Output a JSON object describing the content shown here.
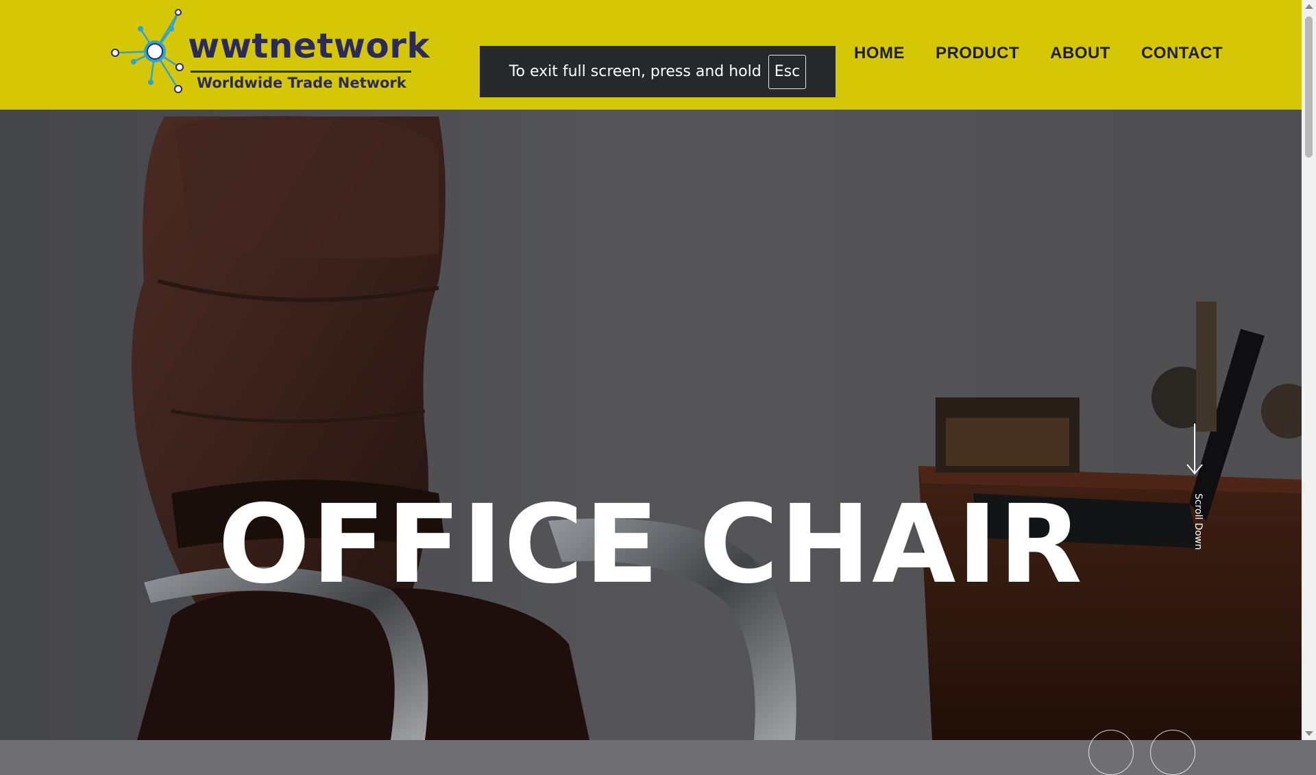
{
  "header": {
    "logo": {
      "name": "wwtnetwork",
      "tagline": "Worldwide Trade Network"
    },
    "nav": [
      {
        "label": "HOME"
      },
      {
        "label": "PRODUCT"
      },
      {
        "label": "ABOUT"
      },
      {
        "label": "CONTACT"
      }
    ]
  },
  "fullscreen_notice": {
    "text": "To exit full screen, press and hold",
    "key": "Esc"
  },
  "hero": {
    "title": "OFFICE CHAIR",
    "scroll_label": "Scroll Down",
    "image_subject": "brown leather office chair beside wooden desk with laptop"
  },
  "colors": {
    "header_bg": "#d5c705",
    "brand_text": "#2b2a5c",
    "logo_accent": "#2aa3d8",
    "nav_text": "#1d1d1d",
    "hero_text": "#ffffff",
    "notice_bg": "#26282b"
  },
  "icons": [
    "network-node-logo-icon",
    "scroll-down-arrow-icon"
  ]
}
